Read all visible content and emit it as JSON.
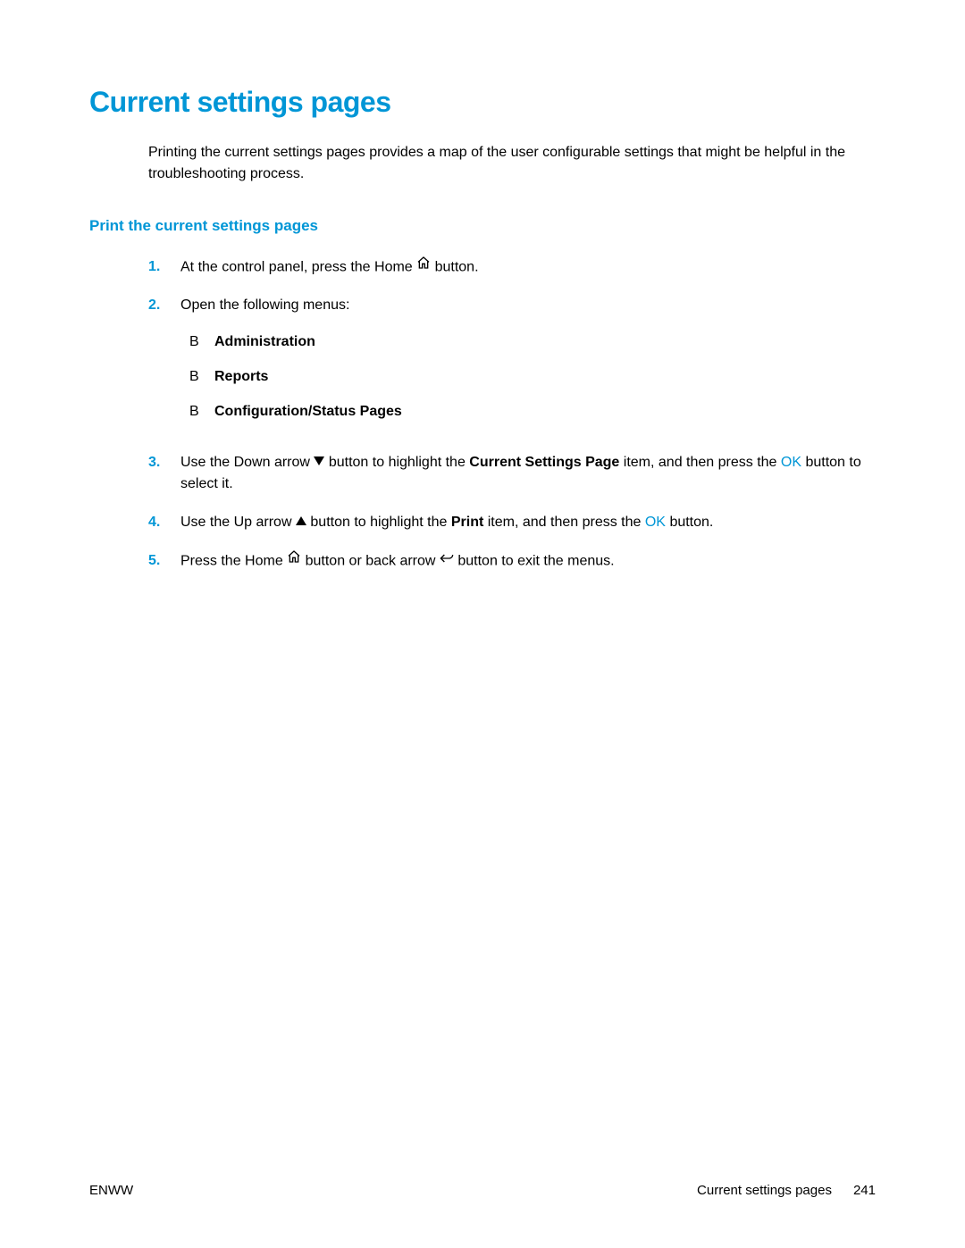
{
  "title": "Current settings pages",
  "intro": "Printing the current settings pages provides a map of the user configurable settings that might be helpful in the troubleshooting process.",
  "subheading": "Print the current settings pages",
  "steps": {
    "s1": {
      "num": "1.",
      "prefix": "At the control panel, press the Home ",
      "suffix": " button."
    },
    "s2": {
      "num": "2.",
      "text": "Open the following menus:",
      "menus": {
        "m1": "Administration",
        "m2": "Reports",
        "m3": "Configuration/Status Pages"
      }
    },
    "s3": {
      "num": "3.",
      "t1": "Use the Down arrow ",
      "t2": " button to highlight the ",
      "bold": "Current Settings Page",
      "t3": " item, and then press the ",
      "ok": "OK",
      "t4": " button to select it."
    },
    "s4": {
      "num": "4.",
      "t1": "Use the Up arrow ",
      "t2": " button to highlight the ",
      "bold": "Print",
      "t3": " item, and then press the ",
      "ok": "OK",
      "t4": " button."
    },
    "s5": {
      "num": "5.",
      "t1": "Press the Home ",
      "t2": " button or back arrow ",
      "t3": " button to exit the menus."
    }
  },
  "bullet": "B",
  "footer": {
    "left": "ENWW",
    "section": "Current settings pages",
    "page": "241"
  }
}
